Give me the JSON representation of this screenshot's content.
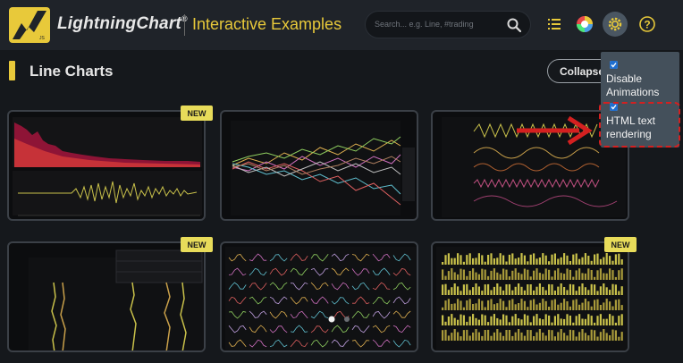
{
  "header": {
    "brand": "LightningChart",
    "brand_mark": "®",
    "subtitle": "Interactive Examples",
    "search_placeholder": "Search... e.g. Line, #trading",
    "colors": {
      "accent": "#e8c93a",
      "bg": "#1f2329"
    },
    "icons": [
      "list-icon",
      "color-theme-icon",
      "gear-icon",
      "help-icon"
    ]
  },
  "section": {
    "title": "Line Charts",
    "collapse_label": "Collapse"
  },
  "cards": [
    {
      "badge": "NEW"
    },
    {
      "badge": ""
    },
    {
      "badge": ""
    },
    {
      "badge": "NEW"
    },
    {
      "badge": ""
    },
    {
      "badge": "NEW"
    }
  ],
  "settings_menu": {
    "items": [
      {
        "label": "Disable Animations",
        "checked": true
      },
      {
        "label": "HTML text rendering",
        "checked": true
      }
    ]
  },
  "pagination": {
    "pages": 2,
    "active": 1
  }
}
